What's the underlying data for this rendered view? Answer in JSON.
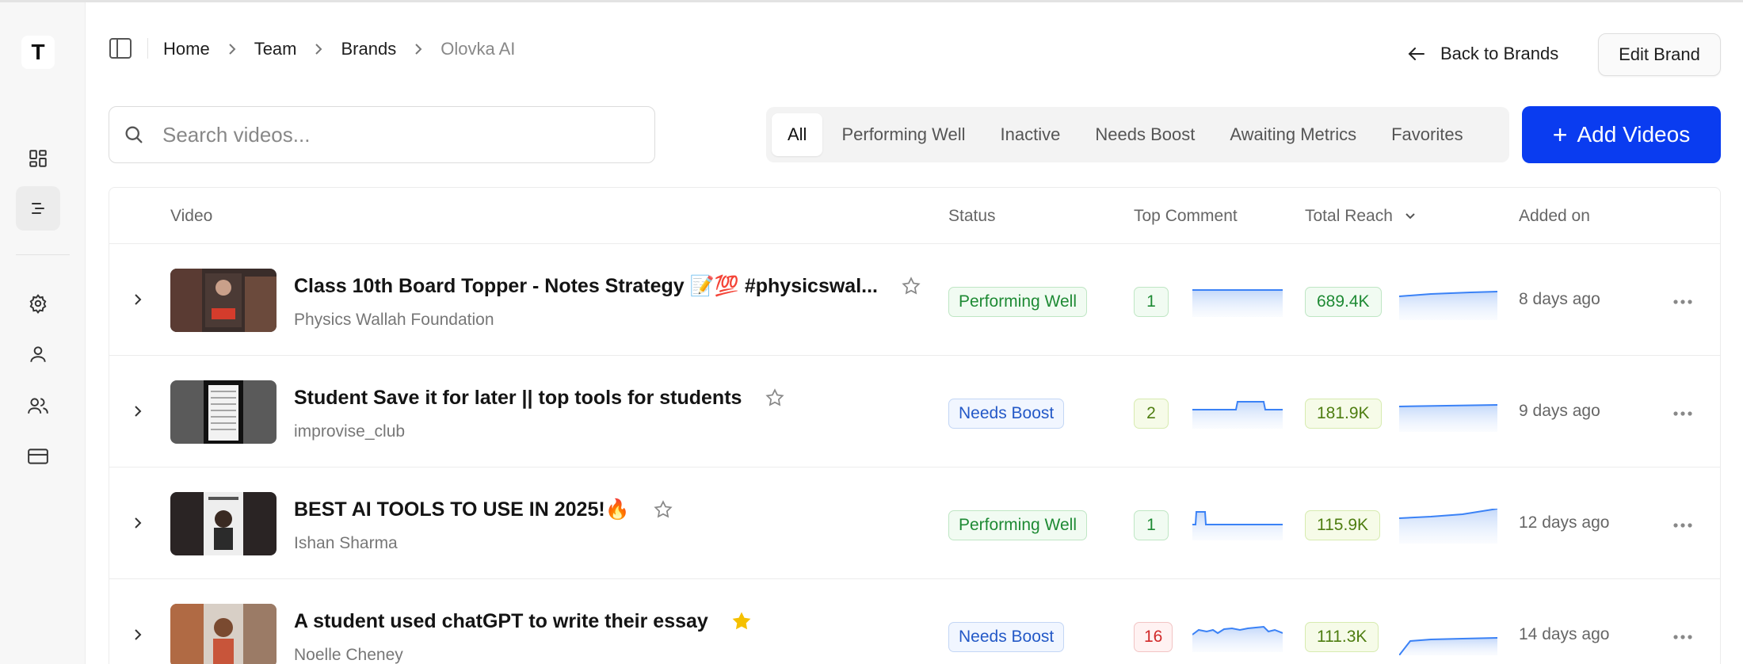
{
  "sidebar": {
    "logo_letter": "T",
    "items": [
      {
        "icon": "dashboard-grid-icon"
      },
      {
        "icon": "list-icon",
        "active": true
      },
      {
        "icon": "gear-icon"
      },
      {
        "icon": "user-icon"
      },
      {
        "icon": "users-icon"
      },
      {
        "icon": "credit-card-icon"
      }
    ]
  },
  "header": {
    "breadcrumb": [
      "Home",
      "Team",
      "Brands",
      "Olovka AI"
    ],
    "back_label": "Back to Brands",
    "edit_label": "Edit Brand"
  },
  "toolbar": {
    "search_placeholder": "Search videos...",
    "tabs": [
      "All",
      "Performing Well",
      "Inactive",
      "Needs Boost",
      "Awaiting Metrics",
      "Favorites"
    ],
    "active_tab": "All",
    "add_label": "Add Videos"
  },
  "table": {
    "columns": [
      "Video",
      "Status",
      "Top Comment",
      "Total Reach",
      "Added on"
    ],
    "sorted_by": "Total Reach",
    "rows": [
      {
        "title": "Class 10th Board Topper - Notes Strategy 📝💯 #physicswal...",
        "channel": "Physics Wallah Foundation",
        "favorite": false,
        "status": "Performing Well",
        "top_comment": "1",
        "total_reach": "689.4K",
        "added_on": "8 days ago"
      },
      {
        "title": "Student Save it for later || top tools for students",
        "channel": "improvise_club",
        "favorite": false,
        "status": "Needs Boost",
        "top_comment": "2",
        "total_reach": "181.9K",
        "added_on": "9 days ago"
      },
      {
        "title": "BEST AI TOOLS TO USE IN 2025!🔥",
        "channel": "Ishan Sharma",
        "favorite": false,
        "status": "Performing Well",
        "top_comment": "1",
        "total_reach": "115.9K",
        "added_on": "12 days ago"
      },
      {
        "title": "A student used chatGPT to write their essay",
        "channel": "Noelle Cheney",
        "favorite": true,
        "status": "Needs Boost",
        "top_comment": "16",
        "total_reach": "111.3K",
        "added_on": "14 days ago"
      }
    ]
  },
  "colors": {
    "accent": "#0a3cf0",
    "status_good": "#1e8a34",
    "status_boost": "#2459c7",
    "star_active": "#f5c000",
    "sparkline": "#3b82f6"
  }
}
